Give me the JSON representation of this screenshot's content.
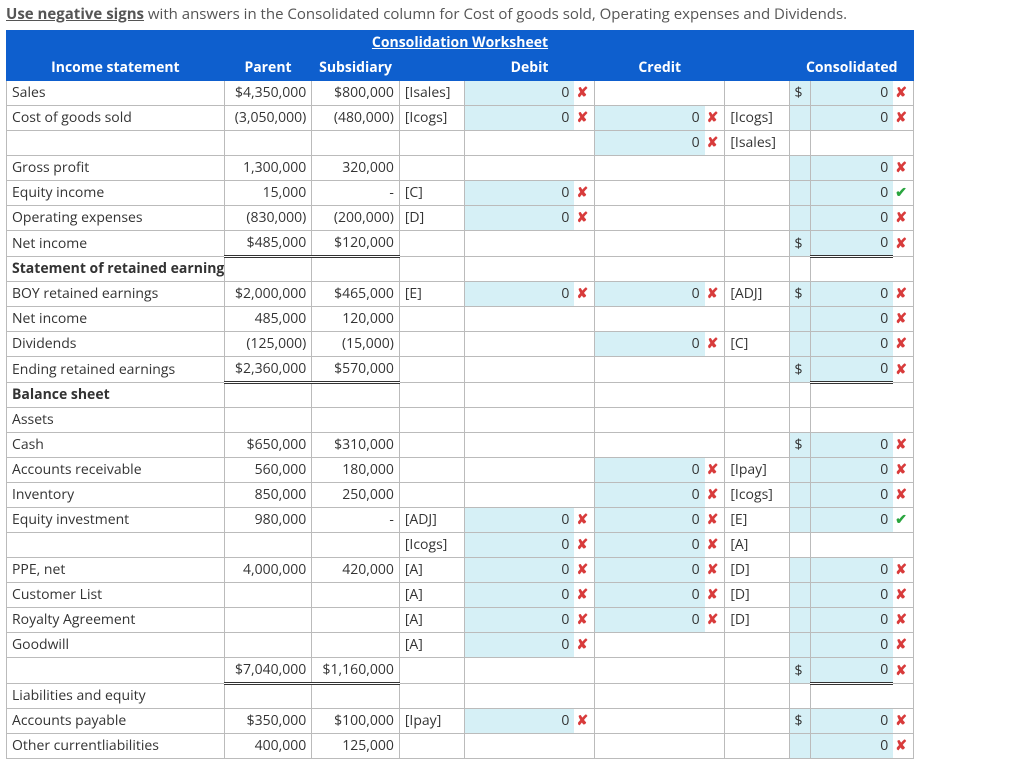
{
  "instruction_prefix": "Use negative signs",
  "instruction_rest": " with answers in the Consolidated column for Cost of goods sold, Operating expenses and Dividends.",
  "worksheet_title": "Consolidation Worksheet",
  "headers": {
    "col1": "Income statement",
    "parent": "Parent",
    "subsidiary": "Subsidiary",
    "debit": "Debit",
    "credit": "Credit",
    "consolidated": "Consolidated"
  },
  "rows": [
    {
      "id": "sales",
      "label": "Sales",
      "parent": "$4,350,000",
      "sub": "$800,000",
      "dcode": "[Isales]",
      "dval": "0",
      "dmark": "x",
      "cdoll": "$",
      "cons": "0",
      "cmk": "x",
      "debit_in": true,
      "cons_in": true
    },
    {
      "id": "cogs",
      "label": "Cost of goods sold",
      "parent": "(3,050,000)",
      "sub": "(480,000)",
      "dcode": "[Icogs]",
      "dval": "0",
      "dmark": "x",
      "cval": "0",
      "cmark": "x",
      "ccode": "[Icogs]",
      "cons": "0",
      "cmk": "x",
      "debit_in": true,
      "credit_in": true,
      "cons_in": true
    },
    {
      "id": "blank1",
      "label": "",
      "cval": "0",
      "cmark": "x",
      "ccode": "[Isales]",
      "credit_in": true
    },
    {
      "id": "gp",
      "label": "Gross profit",
      "parent": "1,300,000",
      "sub": "320,000",
      "cons": "0",
      "cmk": "x",
      "cons_in": true,
      "topline": true
    },
    {
      "id": "eqinc",
      "label": "Equity income",
      "parent": "15,000",
      "sub": "-",
      "dcode": "[C]",
      "dval": "0",
      "dmark": "x",
      "cons": "0",
      "cmk": "ok",
      "debit_in": true,
      "cons_in": true
    },
    {
      "id": "opex",
      "label": "Operating expenses",
      "parent": "(830,000)",
      "sub": "(200,000)",
      "dcode": "[D]",
      "dval": "0",
      "dmark": "x",
      "cons": "0",
      "cmk": "x",
      "debit_in": true,
      "cons_in": true
    },
    {
      "id": "ni",
      "label": "Net income",
      "parent": "$485,000",
      "sub": "$120,000",
      "cdoll": "$",
      "cons": "0",
      "cmk": "x",
      "cons_in": true,
      "dbl": true
    },
    {
      "id": "sre",
      "label": "Statement of retained earnings",
      "section": true
    },
    {
      "id": "boyre",
      "label": "BOY retained earnings",
      "parent": "$2,000,000",
      "sub": "$465,000",
      "dcode": "[E]",
      "dval": "0",
      "dmark": "x",
      "cval": "0",
      "cmark": "x",
      "ccode": "[ADJ]",
      "cdoll": "$",
      "cons": "0",
      "cmk": "x",
      "debit_in": true,
      "credit_in": true,
      "cons_in": true
    },
    {
      "id": "ni2",
      "label": "Net income",
      "parent": "485,000",
      "sub": "120,000",
      "cons": "0",
      "cmk": "x",
      "cons_in": true
    },
    {
      "id": "div",
      "label": "Dividends",
      "parent": "(125,000)",
      "sub": "(15,000)",
      "cval": "0",
      "cmark": "x",
      "ccode": "[C]",
      "cons": "0",
      "cmk": "x",
      "credit_in": true,
      "cons_in": true
    },
    {
      "id": "ere",
      "label": "Ending retained earnings",
      "parent": "$2,360,000",
      "sub": "$570,000",
      "cdoll": "$",
      "cons": "0",
      "cmk": "x",
      "cons_in": true,
      "dbl": true
    },
    {
      "id": "bs",
      "label": "Balance sheet",
      "section": true
    },
    {
      "id": "assets",
      "label": "Assets"
    },
    {
      "id": "cash",
      "label": "Cash",
      "parent": "$650,000",
      "sub": "$310,000",
      "cdoll": "$",
      "cons": "0",
      "cmk": "x",
      "cons_in": true
    },
    {
      "id": "ar",
      "label": "Accounts receivable",
      "parent": "560,000",
      "sub": "180,000",
      "cval": "0",
      "cmark": "x",
      "ccode": "[Ipay]",
      "cons": "0",
      "cmk": "x",
      "credit_in": true,
      "cons_in": true
    },
    {
      "id": "inv",
      "label": "Inventory",
      "parent": "850,000",
      "sub": "250,000",
      "cval": "0",
      "cmark": "x",
      "ccode": "[Icogs]",
      "cons": "0",
      "cmk": "x",
      "credit_in": true,
      "cons_in": true
    },
    {
      "id": "eqinv",
      "label": "Equity investment",
      "parent": "980,000",
      "sub": "-",
      "dcode": "[ADJ]",
      "dval": "0",
      "dmark": "x",
      "cval": "0",
      "cmark": "x",
      "ccode": "[E]",
      "cons": "0",
      "cmk": "ok",
      "debit_in": true,
      "credit_in": true,
      "cons_in": true
    },
    {
      "id": "blank2",
      "label": "",
      "dcode": "[Icogs]",
      "dval": "0",
      "dmark": "x",
      "cval": "0",
      "cmark": "x",
      "ccode": "[A]",
      "debit_in": true,
      "credit_in": true
    },
    {
      "id": "ppe",
      "label": "PPE, net",
      "parent": "4,000,000",
      "sub": "420,000",
      "dcode": "[A]",
      "dval": "0",
      "dmark": "x",
      "cval": "0",
      "cmark": "x",
      "ccode": "[D]",
      "cons": "0",
      "cmk": "x",
      "debit_in": true,
      "credit_in": true,
      "cons_in": true
    },
    {
      "id": "cust",
      "label": "Customer List",
      "dcode": "[A]",
      "dval": "0",
      "dmark": "x",
      "cval": "0",
      "cmark": "x",
      "ccode": "[D]",
      "cons": "0",
      "cmk": "x",
      "debit_in": true,
      "credit_in": true,
      "cons_in": true
    },
    {
      "id": "roy",
      "label": "Royalty Agreement",
      "dcode": "[A]",
      "dval": "0",
      "dmark": "x",
      "cval": "0",
      "cmark": "x",
      "ccode": "[D]",
      "cons": "0",
      "cmk": "x",
      "debit_in": true,
      "credit_in": true,
      "cons_in": true
    },
    {
      "id": "gw",
      "label": "Goodwill",
      "dcode": "[A]",
      "dval": "0",
      "dmark": "x",
      "cons": "0",
      "cmk": "x",
      "debit_in": true,
      "cons_in": true
    },
    {
      "id": "tassets",
      "label": "",
      "parent": "$7,040,000",
      "sub": "$1,160,000",
      "cdoll": "$",
      "cons": "0",
      "cmk": "x",
      "cons_in": true,
      "dbl": true
    },
    {
      "id": "le",
      "label": "Liabilities and equity"
    },
    {
      "id": "ap",
      "label": "Accounts payable",
      "parent": "$350,000",
      "sub": "$100,000",
      "dcode": "[Ipay]",
      "dval": "0",
      "dmark": "x",
      "cdoll": "$",
      "cons": "0",
      "cmk": "x",
      "debit_in": true,
      "cons_in": true
    },
    {
      "id": "ocl",
      "label": "Other currentliabilities",
      "parent": "400,000",
      "sub": "125,000",
      "cons": "0",
      "cmk": "x",
      "cons_in": true
    }
  ]
}
